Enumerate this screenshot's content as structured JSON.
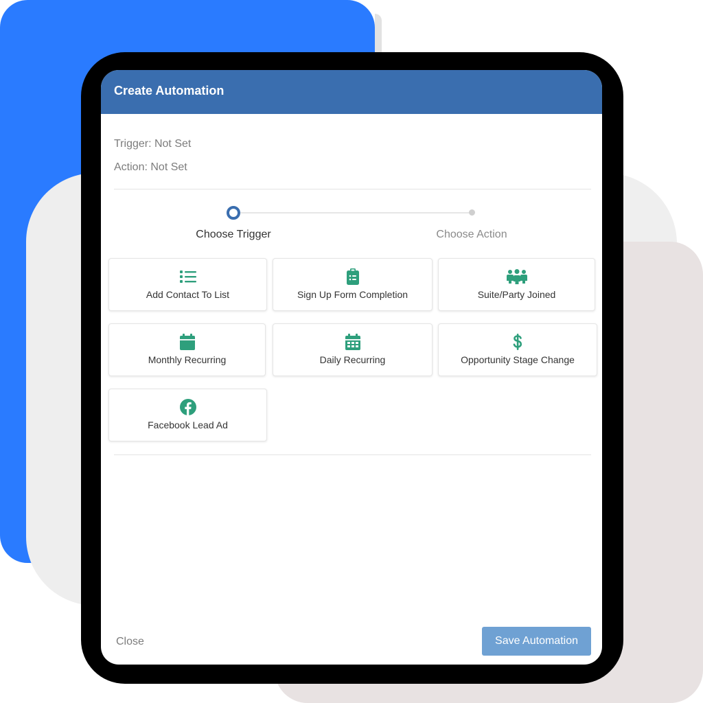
{
  "dialog": {
    "title": "Create Automation",
    "trigger_status": "Trigger: Not Set",
    "action_status": "Action: Not Set"
  },
  "stepper": {
    "steps": [
      {
        "label": "Choose Trigger",
        "state": "active"
      },
      {
        "label": "Choose Action",
        "state": "inactive"
      }
    ]
  },
  "triggers": [
    {
      "label": "Add Contact To List",
      "icon": "list-icon"
    },
    {
      "label": "Sign Up Form Completion",
      "icon": "clipboard-icon"
    },
    {
      "label": "Suite/Party Joined",
      "icon": "users-icon"
    },
    {
      "label": "Monthly Recurring",
      "icon": "calendar-icon"
    },
    {
      "label": "Daily Recurring",
      "icon": "calendar-days-icon"
    },
    {
      "label": "Opportunity Stage Change",
      "icon": "dollar-icon"
    },
    {
      "label": "Facebook Lead Ad",
      "icon": "facebook-icon"
    }
  ],
  "footer": {
    "close_label": "Close",
    "save_label": "Save Automation"
  },
  "colors": {
    "header": "#3a6eaf",
    "icon_green": "#2e9f7c",
    "save_button": "#6fa1d3",
    "backdrop_blue": "#2a7bff"
  }
}
